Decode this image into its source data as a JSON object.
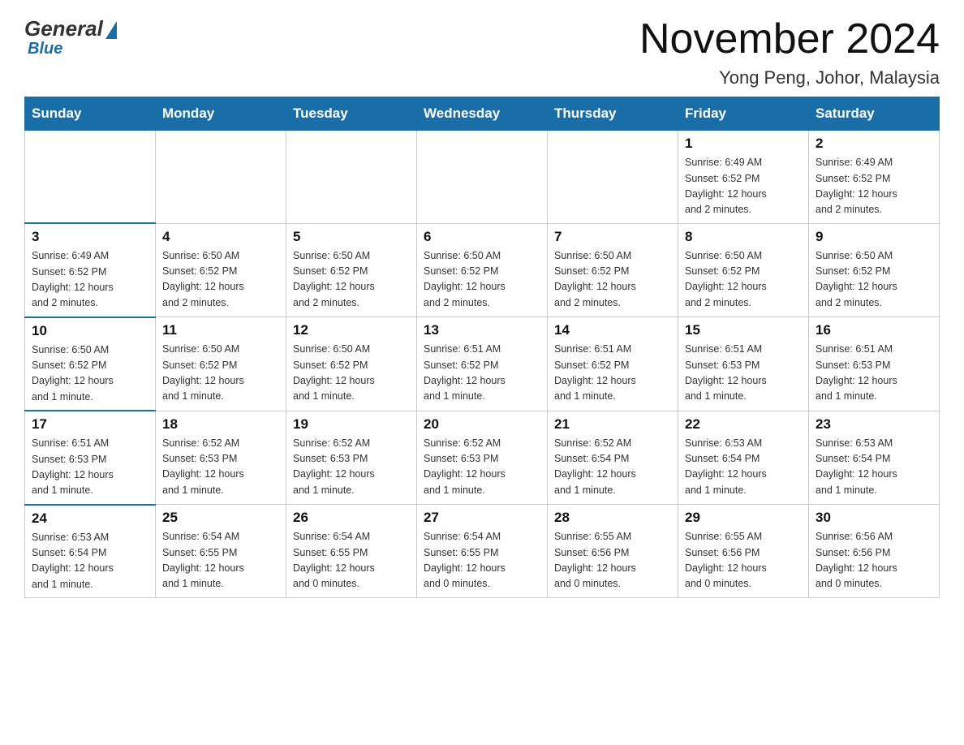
{
  "logo": {
    "general": "General",
    "blue": "Blue"
  },
  "title": "November 2024",
  "subtitle": "Yong Peng, Johor, Malaysia",
  "weekdays": [
    "Sunday",
    "Monday",
    "Tuesday",
    "Wednesday",
    "Thursday",
    "Friday",
    "Saturday"
  ],
  "weeks": [
    [
      {
        "day": "",
        "info": ""
      },
      {
        "day": "",
        "info": ""
      },
      {
        "day": "",
        "info": ""
      },
      {
        "day": "",
        "info": ""
      },
      {
        "day": "",
        "info": ""
      },
      {
        "day": "1",
        "info": "Sunrise: 6:49 AM\nSunset: 6:52 PM\nDaylight: 12 hours\nand 2 minutes."
      },
      {
        "day": "2",
        "info": "Sunrise: 6:49 AM\nSunset: 6:52 PM\nDaylight: 12 hours\nand 2 minutes."
      }
    ],
    [
      {
        "day": "3",
        "info": "Sunrise: 6:49 AM\nSunset: 6:52 PM\nDaylight: 12 hours\nand 2 minutes."
      },
      {
        "day": "4",
        "info": "Sunrise: 6:50 AM\nSunset: 6:52 PM\nDaylight: 12 hours\nand 2 minutes."
      },
      {
        "day": "5",
        "info": "Sunrise: 6:50 AM\nSunset: 6:52 PM\nDaylight: 12 hours\nand 2 minutes."
      },
      {
        "day": "6",
        "info": "Sunrise: 6:50 AM\nSunset: 6:52 PM\nDaylight: 12 hours\nand 2 minutes."
      },
      {
        "day": "7",
        "info": "Sunrise: 6:50 AM\nSunset: 6:52 PM\nDaylight: 12 hours\nand 2 minutes."
      },
      {
        "day": "8",
        "info": "Sunrise: 6:50 AM\nSunset: 6:52 PM\nDaylight: 12 hours\nand 2 minutes."
      },
      {
        "day": "9",
        "info": "Sunrise: 6:50 AM\nSunset: 6:52 PM\nDaylight: 12 hours\nand 2 minutes."
      }
    ],
    [
      {
        "day": "10",
        "info": "Sunrise: 6:50 AM\nSunset: 6:52 PM\nDaylight: 12 hours\nand 1 minute."
      },
      {
        "day": "11",
        "info": "Sunrise: 6:50 AM\nSunset: 6:52 PM\nDaylight: 12 hours\nand 1 minute."
      },
      {
        "day": "12",
        "info": "Sunrise: 6:50 AM\nSunset: 6:52 PM\nDaylight: 12 hours\nand 1 minute."
      },
      {
        "day": "13",
        "info": "Sunrise: 6:51 AM\nSunset: 6:52 PM\nDaylight: 12 hours\nand 1 minute."
      },
      {
        "day": "14",
        "info": "Sunrise: 6:51 AM\nSunset: 6:52 PM\nDaylight: 12 hours\nand 1 minute."
      },
      {
        "day": "15",
        "info": "Sunrise: 6:51 AM\nSunset: 6:53 PM\nDaylight: 12 hours\nand 1 minute."
      },
      {
        "day": "16",
        "info": "Sunrise: 6:51 AM\nSunset: 6:53 PM\nDaylight: 12 hours\nand 1 minute."
      }
    ],
    [
      {
        "day": "17",
        "info": "Sunrise: 6:51 AM\nSunset: 6:53 PM\nDaylight: 12 hours\nand 1 minute."
      },
      {
        "day": "18",
        "info": "Sunrise: 6:52 AM\nSunset: 6:53 PM\nDaylight: 12 hours\nand 1 minute."
      },
      {
        "day": "19",
        "info": "Sunrise: 6:52 AM\nSunset: 6:53 PM\nDaylight: 12 hours\nand 1 minute."
      },
      {
        "day": "20",
        "info": "Sunrise: 6:52 AM\nSunset: 6:53 PM\nDaylight: 12 hours\nand 1 minute."
      },
      {
        "day": "21",
        "info": "Sunrise: 6:52 AM\nSunset: 6:54 PM\nDaylight: 12 hours\nand 1 minute."
      },
      {
        "day": "22",
        "info": "Sunrise: 6:53 AM\nSunset: 6:54 PM\nDaylight: 12 hours\nand 1 minute."
      },
      {
        "day": "23",
        "info": "Sunrise: 6:53 AM\nSunset: 6:54 PM\nDaylight: 12 hours\nand 1 minute."
      }
    ],
    [
      {
        "day": "24",
        "info": "Sunrise: 6:53 AM\nSunset: 6:54 PM\nDaylight: 12 hours\nand 1 minute."
      },
      {
        "day": "25",
        "info": "Sunrise: 6:54 AM\nSunset: 6:55 PM\nDaylight: 12 hours\nand 1 minute."
      },
      {
        "day": "26",
        "info": "Sunrise: 6:54 AM\nSunset: 6:55 PM\nDaylight: 12 hours\nand 0 minutes."
      },
      {
        "day": "27",
        "info": "Sunrise: 6:54 AM\nSunset: 6:55 PM\nDaylight: 12 hours\nand 0 minutes."
      },
      {
        "day": "28",
        "info": "Sunrise: 6:55 AM\nSunset: 6:56 PM\nDaylight: 12 hours\nand 0 minutes."
      },
      {
        "day": "29",
        "info": "Sunrise: 6:55 AM\nSunset: 6:56 PM\nDaylight: 12 hours\nand 0 minutes."
      },
      {
        "day": "30",
        "info": "Sunrise: 6:56 AM\nSunset: 6:56 PM\nDaylight: 12 hours\nand 0 minutes."
      }
    ]
  ]
}
